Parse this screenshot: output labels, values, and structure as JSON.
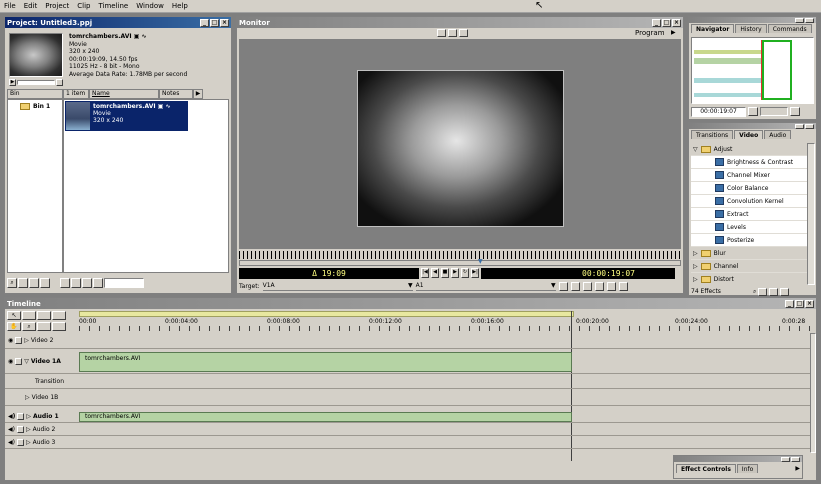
{
  "menu": [
    "File",
    "Edit",
    "Project",
    "Clip",
    "Timeline",
    "Window",
    "Help"
  ],
  "project": {
    "title": "Project: Untitled3.ppj",
    "preview": {
      "name": "tomrchambers.AVI",
      "lines": [
        "Movie",
        "320 x 240",
        "00:00:19:09, 14.50 fps",
        "11025 Hz - 8 bit - Mono",
        "Average Data Rate: 1.78MB per second"
      ]
    },
    "bin_header": "Bin",
    "items_count": "1 item",
    "col_name": "Name",
    "col_notes": "Notes",
    "bin_name": "Bin 1",
    "clip": {
      "name": "tomrchambers.AVI",
      "type": "Movie",
      "size": "320 x 240"
    }
  },
  "monitor": {
    "title": "Monitor",
    "mode": "Program",
    "duration": "Δ 19:09",
    "timecode": "00:00:19:07",
    "target_label": "Target:",
    "target_video": "V1A",
    "target_audio": "A1"
  },
  "navigator": {
    "tabs": [
      "Navigator",
      "History",
      "Commands"
    ],
    "timecode": "00:00:19:07"
  },
  "effects": {
    "tabs": [
      "Transitions",
      "Video",
      "Audio"
    ],
    "folders": [
      {
        "label": "Adjust",
        "open": true,
        "items": [
          "Brightness & Contrast",
          "Channel Mixer",
          "Color Balance",
          "Convolution Kernel",
          "Extract",
          "Levels",
          "Posterize"
        ]
      },
      {
        "label": "Blur",
        "open": false
      },
      {
        "label": "Channel",
        "open": false
      },
      {
        "label": "Distort",
        "open": false
      }
    ],
    "count": "74 Effects"
  },
  "timeline": {
    "title": "Timeline",
    "ruler": [
      "00:00",
      "0:00:04:00",
      "0:00:08:00",
      "0:00:12:00",
      "0:00:16:00",
      "0:00:20:00",
      "0:00:24:00",
      "0:00:28"
    ],
    "tracks": {
      "video2": "Video 2",
      "video1a": "Video 1A",
      "transition": "Transition",
      "video1b": "Video 1B",
      "audio1": "Audio 1",
      "audio2": "Audio 2",
      "audio3": "Audio 3"
    },
    "clip_label": "tomrchambers.AVI"
  },
  "effect_controls": {
    "tabs": [
      "Effect Controls",
      "Info"
    ]
  },
  "colors": {
    "title_active": "#0a246a",
    "clip_green": "#b5d3a4",
    "timecode_bg": "#000000",
    "timecode_fg": "#ffff80"
  }
}
